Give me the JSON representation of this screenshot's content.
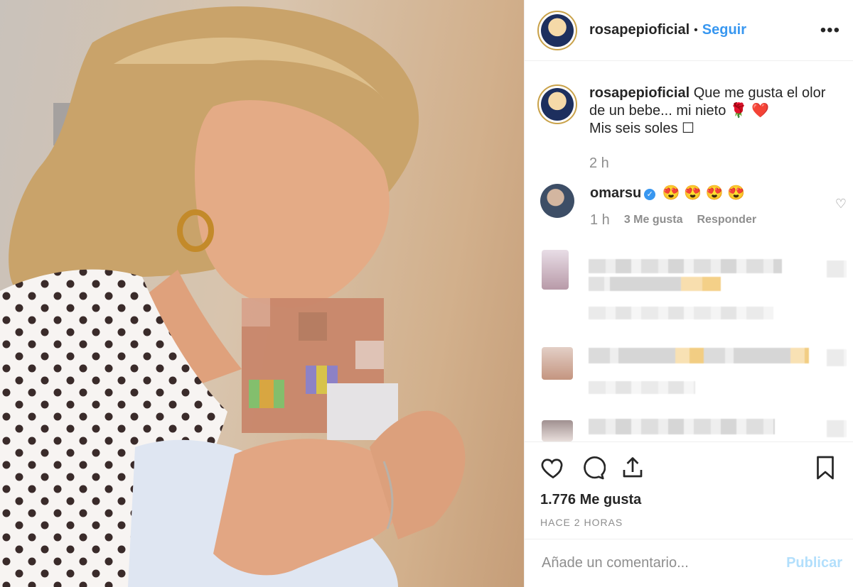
{
  "header": {
    "username": "rosapepioficial",
    "separator": "•",
    "follow_label": "Seguir",
    "more_icon": "more-horizontal-icon"
  },
  "caption": {
    "username": "rosapepioficial",
    "line1": "Que me gusta el olor",
    "line2": "de un bebe... mi nieto 🌹 ❤️",
    "line3": "Mis seis soles ☐",
    "time": "2 h"
  },
  "comment": {
    "username": "omarsu",
    "text": "😍 😍 😍 😍",
    "time": "1 h",
    "likes": "3 Me gusta",
    "reply": "Responder"
  },
  "footer": {
    "likes": "1.776 Me gusta",
    "date": "HACE 2 HORAS",
    "comment_placeholder": "Añade un comentario...",
    "publish_label": "Publicar"
  },
  "colors": {
    "link": "#3897f0",
    "muted": "#8e8e8e",
    "publish_disabled": "#b2dffc",
    "text": "#262626"
  }
}
